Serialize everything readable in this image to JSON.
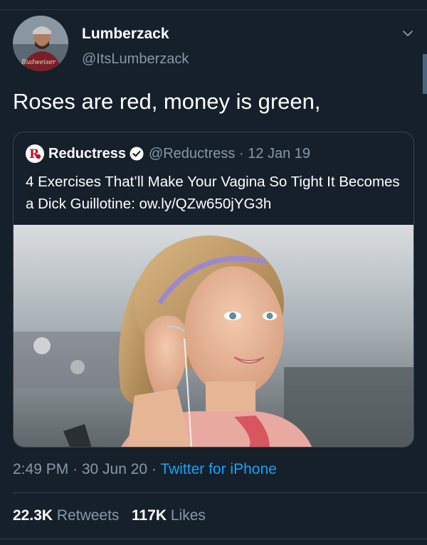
{
  "tweet": {
    "author": {
      "display_name": "Lumberzack",
      "handle": "@ItsLumberzack",
      "avatar_icon": "avatar-photo-icon"
    },
    "text": "Roses are red, money is green,",
    "timestamp": "2:49 PM · 30 Jun 20 · ",
    "source": "Twitter for iPhone",
    "stats": {
      "retweets_count": "22.3K",
      "retweets_label": "Retweets",
      "likes_count": "117K",
      "likes_label": "Likes"
    }
  },
  "quoted_tweet": {
    "author": {
      "display_name": "Reductress",
      "verified": true,
      "handle": "@Reductress",
      "date": "12 Jan 19"
    },
    "text": "4 Exercises That’ll Make Your Vagina So Tight It Becomes a Dick Guillotine: ow.ly/QZw650jYG3h",
    "image_description_icon": "photo-woman-headband-icon"
  },
  "colors": {
    "background": "#15202b",
    "text_primary": "#ffffff",
    "text_secondary": "#8899a6",
    "link": "#1da1f2",
    "border": "#38444d",
    "verified": "#ffffff"
  }
}
